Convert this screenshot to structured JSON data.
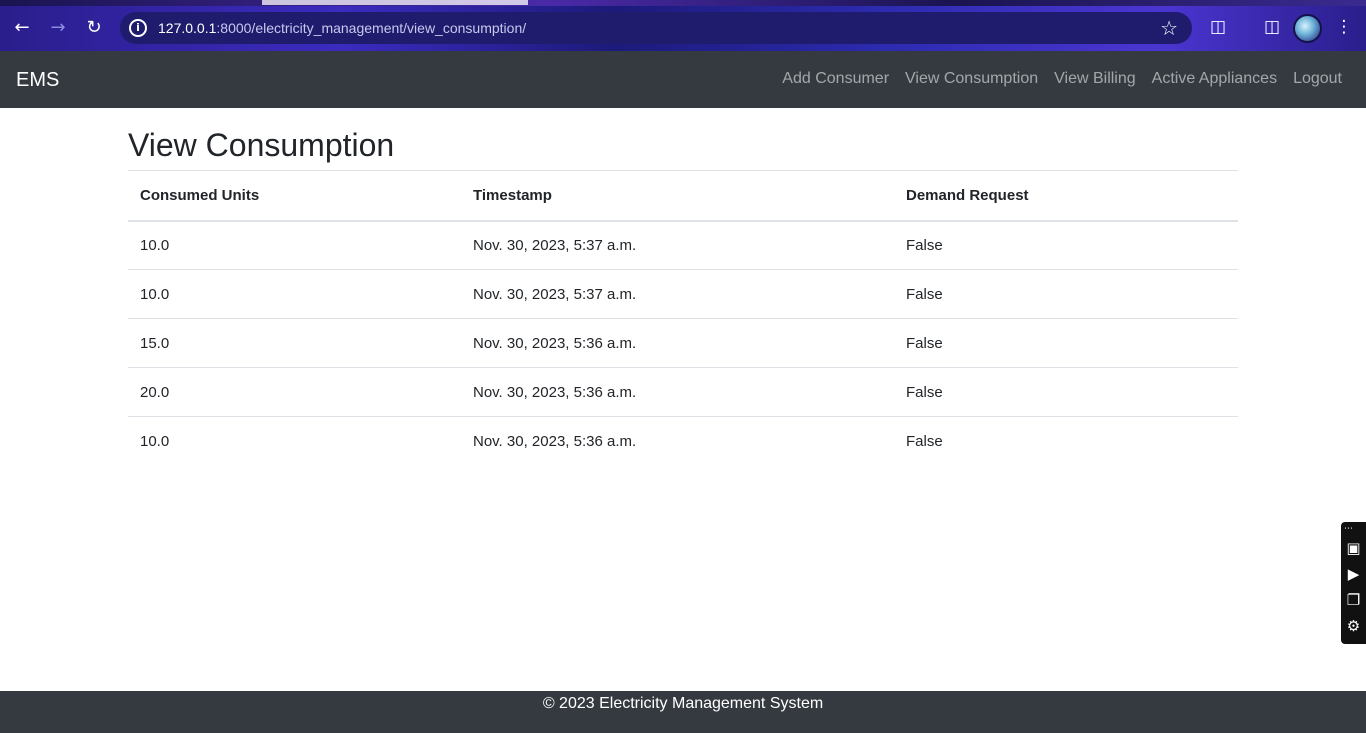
{
  "browser": {
    "url_host": "127.0.0.1",
    "url_path": ":8000/electricity_management/view_consumption/",
    "icons": {
      "back": "back-arrow-icon",
      "forward": "forward-arrow-icon",
      "reload": "reload-icon",
      "site_info": "info-icon",
      "bookmark": "star-icon",
      "extensions": "puzzle-icon",
      "side_panel": "side-panel-icon",
      "profile": "avatar",
      "menu": "kebab-menu-icon"
    }
  },
  "navbar": {
    "brand": "EMS",
    "links": [
      "Add Consumer",
      "View Consumption",
      "View Billing",
      "Active Appliances",
      "Logout"
    ]
  },
  "main": {
    "title": "View Consumption",
    "table": {
      "headers": [
        "Consumed Units",
        "Timestamp",
        "Demand Request"
      ],
      "rows": [
        [
          "10.0",
          "Nov. 30, 2023, 5:37 a.m.",
          "False"
        ],
        [
          "10.0",
          "Nov. 30, 2023, 5:37 a.m.",
          "False"
        ],
        [
          "15.0",
          "Nov. 30, 2023, 5:36 a.m.",
          "False"
        ],
        [
          "20.0",
          "Nov. 30, 2023, 5:36 a.m.",
          "False"
        ],
        [
          "10.0",
          "Nov. 30, 2023, 5:36 a.m.",
          "False"
        ]
      ]
    }
  },
  "footer": {
    "text": "© 2023 Electricity Management System"
  },
  "colors": {
    "navbar_bg": "#343a40",
    "nav_link": "#9a9da0",
    "table_border": "#dee2e6",
    "text": "#212529"
  }
}
